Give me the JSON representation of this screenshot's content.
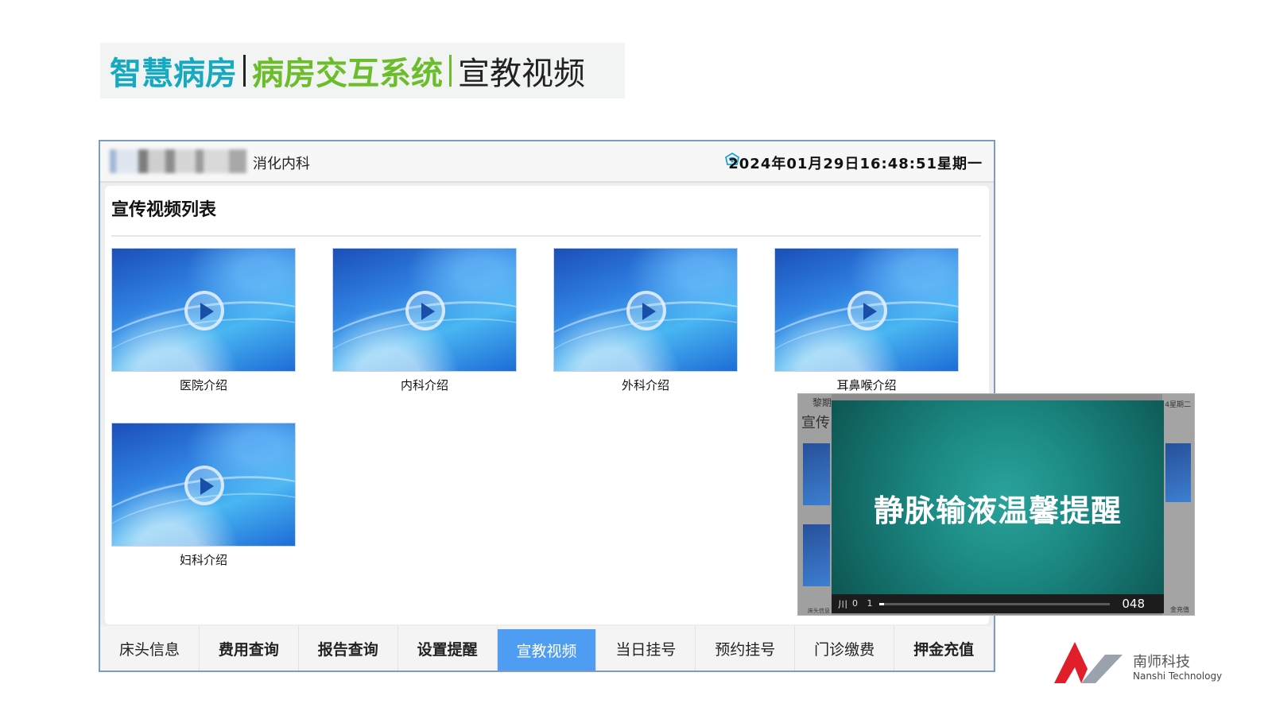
{
  "slide_title": {
    "part1": "智慧病房",
    "part2": "病房交互系统",
    "part3": "宣教视频"
  },
  "topbar": {
    "department": "消化内科",
    "datetime": "2024年01月29日16:48:51星期一",
    "network_icon": "network-status-icon"
  },
  "main": {
    "section_title": "宣传视频列表",
    "videos": [
      {
        "caption": "医院介绍"
      },
      {
        "caption": "内科介绍"
      },
      {
        "caption": "外科介绍"
      },
      {
        "caption": "耳鼻喉介绍"
      },
      {
        "caption": "妇科介绍"
      }
    ]
  },
  "nav": {
    "items": [
      {
        "label": "床头信息"
      },
      {
        "label": "费用查询"
      },
      {
        "label": "报告查询"
      },
      {
        "label": "设置提醒"
      },
      {
        "label": "宣教视频"
      },
      {
        "label": "当日挂号"
      },
      {
        "label": "预约挂号"
      },
      {
        "label": "门诊缴费"
      },
      {
        "label": "押金充值"
      }
    ],
    "active_label": "宣教视频"
  },
  "overlay": {
    "bg_left_text1": "黎期",
    "bg_left_text2": "宣传",
    "bg_right_text": "4星期二",
    "bg_bottom_left": "床头信息",
    "bg_bottom_right": "金充值",
    "player_title": "静脉输液温馨提醒",
    "controls_pause": "川",
    "controls_volume": "0 1",
    "controls_time": "048",
    "progress": 0.02
  },
  "logo": {
    "name_cn": "南师科技",
    "name_en": "Nanshi Technology"
  },
  "colors": {
    "title_cyan": "#17a9c0",
    "title_green": "#6cbd2b",
    "nav_active": "#4f9df2",
    "logo_red": "#e01f2a"
  }
}
